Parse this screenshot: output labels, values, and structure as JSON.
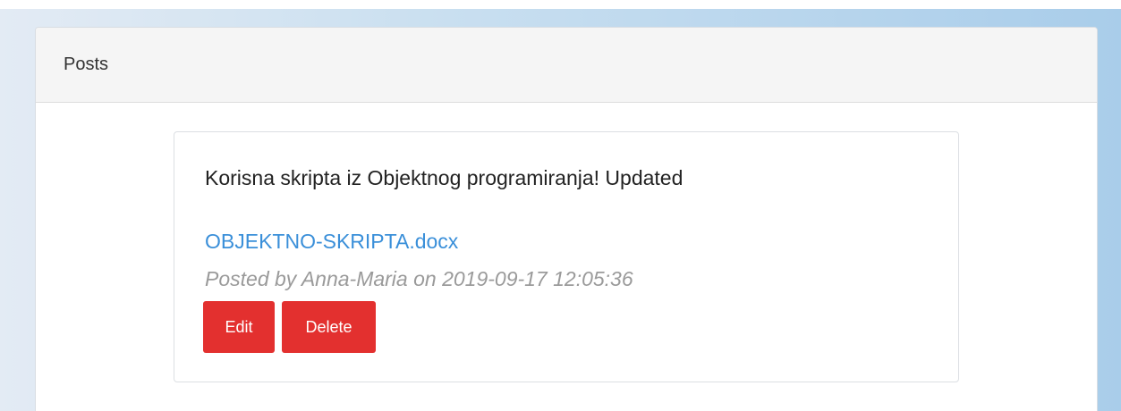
{
  "panel": {
    "heading": "Posts"
  },
  "post": {
    "title": "Korisna skripta iz Objektnog programiranja! Updated",
    "attachment": "OBJEKTNO-SKRIPTA.docx",
    "meta": "Posted by Anna-Maria on 2019-09-17 12:05:36",
    "actions": {
      "edit_label": "Edit",
      "delete_label": "Delete"
    }
  },
  "colors": {
    "button": "#e3302f",
    "link": "#3a8fd9",
    "meta_text": "#9a9a9a"
  }
}
